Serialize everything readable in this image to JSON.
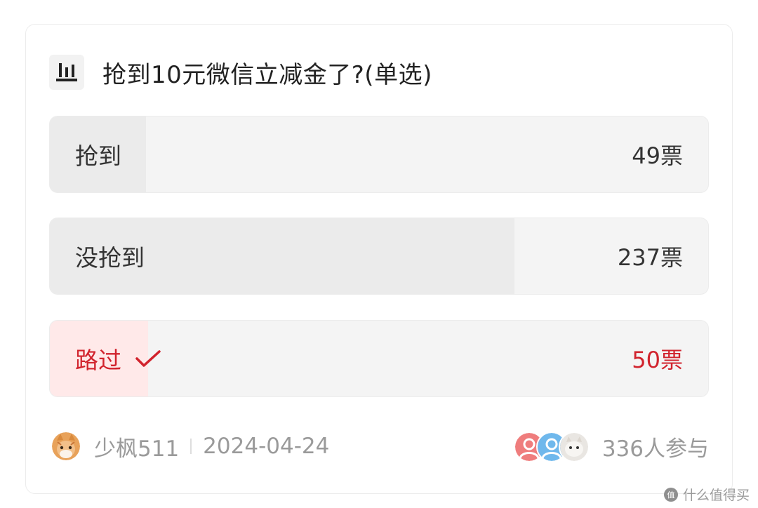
{
  "poll": {
    "title": "抢到10元微信立减金了?(单选)",
    "options": [
      {
        "label": "抢到",
        "votes_label": "49票",
        "votes": 49,
        "selected": false
      },
      {
        "label": "没抢到",
        "votes_label": "237票",
        "votes": 237,
        "selected": false
      },
      {
        "label": "路过",
        "votes_label": "50票",
        "votes": 50,
        "selected": true
      }
    ],
    "total_votes": 336
  },
  "footer": {
    "author": "少枫511",
    "date": "2024-04-24",
    "participants": "336人参与"
  },
  "watermark": {
    "text": "什么值得买"
  },
  "icons": {
    "poll": "bar-chart-icon",
    "check": "checkmark-icon"
  },
  "colors": {
    "accent": "#d1232d",
    "selected_fill": "#ffe9e9",
    "option_bg": "#f4f4f4",
    "option_fill": "#ebebeb"
  }
}
